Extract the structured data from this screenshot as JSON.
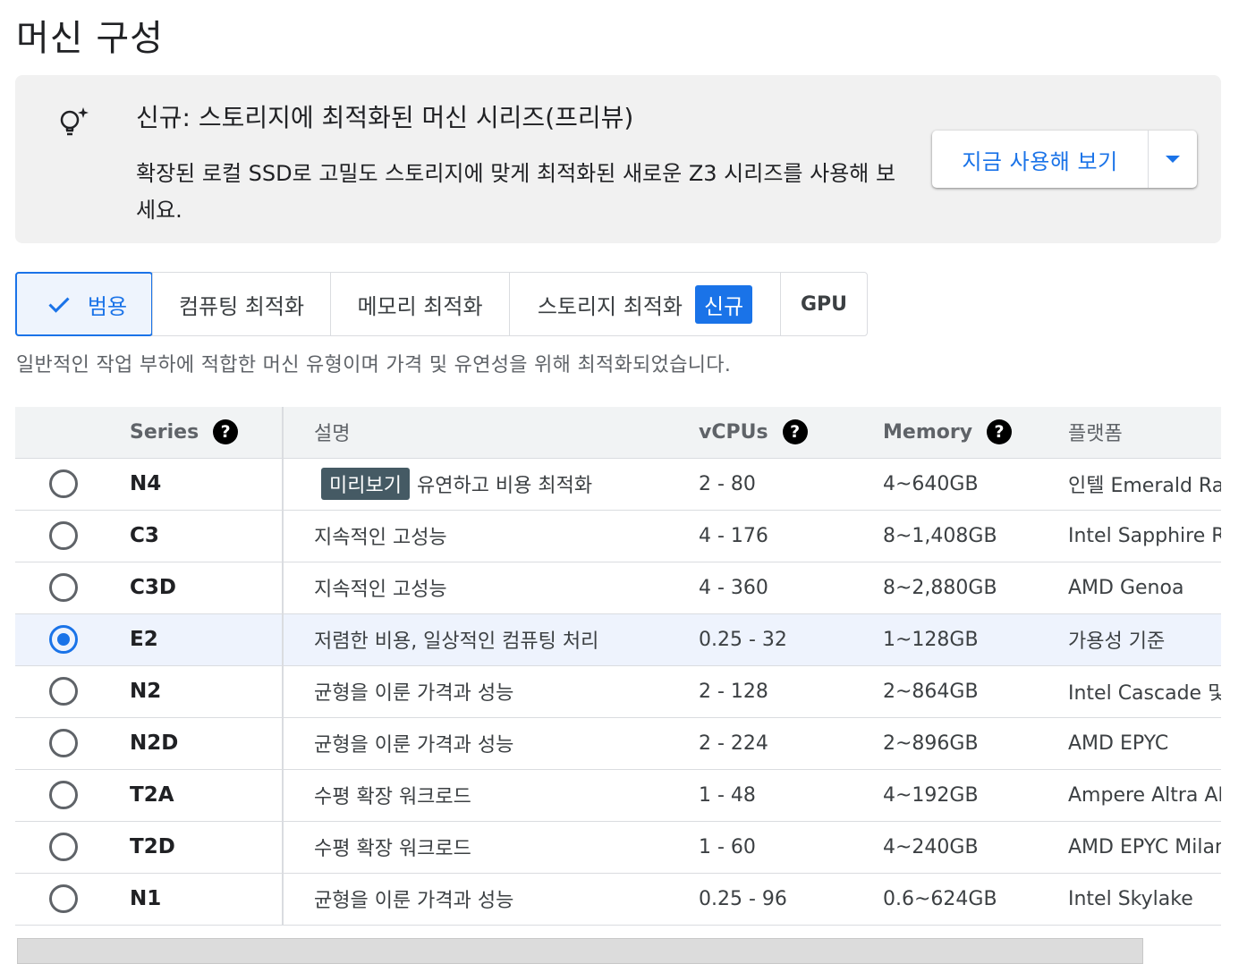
{
  "page": {
    "title": "머신 구성"
  },
  "banner": {
    "title": "신규: 스토리지에 최적화된 머신 시리즈(프리뷰)",
    "body": "확장된 로컬 SSD로 고밀도 스토리지에 맞게 최적화된 새로운 Z3 시리즈를 사용해 보세요.",
    "icon": "lightbulb-sparkle-icon",
    "button_label": "지금 사용해 보기"
  },
  "tabs": {
    "items": [
      {
        "label": "범용",
        "selected": true
      },
      {
        "label": "컴퓨팅 최적화"
      },
      {
        "label": "메모리 최적화"
      },
      {
        "label": "스토리지 최적화",
        "badge": "신규"
      },
      {
        "label": "GPU"
      }
    ]
  },
  "description": "일반적인 작업 부하에 적합한 머신 유형이며 가격 및 유연성을 위해 최적화되었습니다.",
  "table": {
    "headers": {
      "series": "Series",
      "desc": "설명",
      "vcpus": "vCPUs",
      "memory": "Memory",
      "platform": "플랫폼"
    },
    "rows": [
      {
        "series": "N4",
        "badge": "미리보기",
        "desc": "유연하고 비용 최적화",
        "vcpus": "2 - 80",
        "memory": "4~640GB",
        "platform": "인텔 Emerald Rapids"
      },
      {
        "series": "C3",
        "desc": "지속적인 고성능",
        "vcpus": "4 - 176",
        "memory": "8~1,408GB",
        "platform": "Intel Sapphire Rapids"
      },
      {
        "series": "C3D",
        "desc": "지속적인 고성능",
        "vcpus": "4 - 360",
        "memory": "8~2,880GB",
        "platform": "AMD Genoa"
      },
      {
        "series": "E2",
        "desc": "저렴한 비용, 일상적인 컴퓨팅 처리",
        "vcpus": "0.25 - 32",
        "memory": "1~128GB",
        "platform": "가용성 기준",
        "selected": true
      },
      {
        "series": "N2",
        "desc": "균형을 이룬 가격과 성능",
        "vcpus": "2 - 128",
        "memory": "2~864GB",
        "platform": "Intel Cascade 및 Ice Lake"
      },
      {
        "series": "N2D",
        "desc": "균형을 이룬 가격과 성능",
        "vcpus": "2 - 224",
        "memory": "2~896GB",
        "platform": "AMD EPYC"
      },
      {
        "series": "T2A",
        "desc": "수평 확장 워크로드",
        "vcpus": "1 - 48",
        "memory": "4~192GB",
        "platform": "Ampere Altra ARM"
      },
      {
        "series": "T2D",
        "desc": "수평 확장 워크로드",
        "vcpus": "1 - 60",
        "memory": "4~240GB",
        "platform": "AMD EPYC Milan"
      },
      {
        "series": "N1",
        "desc": "균형을 이룬 가격과 성능",
        "vcpus": "0.25 - 96",
        "memory": "0.6~624GB",
        "platform": "Intel Skylake"
      }
    ]
  },
  "colors": {
    "accent": "#1a73e8",
    "badge_preview": "#455a64"
  }
}
